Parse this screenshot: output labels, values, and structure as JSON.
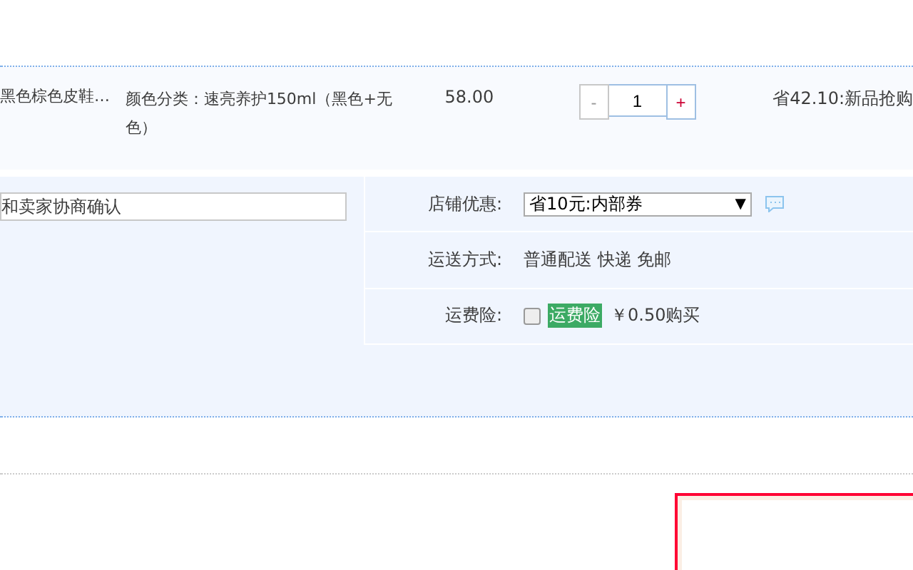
{
  "item": {
    "name": "黑色棕色皮鞋…",
    "sku": "颜色分类：速亮养护150ml（黑色+无色）",
    "price": "58.00",
    "quantity": {
      "minus": "-",
      "value": "1",
      "plus": "+"
    },
    "promotion": "省42.10:新品抢购"
  },
  "message": {
    "placeholder": "和卖家协商确认"
  },
  "options": [
    {
      "kind": "select",
      "label": "店铺优惠:",
      "value": "省10元:内部券",
      "arrow": "▼"
    },
    {
      "kind": "text",
      "label": "运送方式:",
      "value": "普通配送 快递 免邮"
    },
    {
      "kind": "insurance",
      "label": "运费险:",
      "checked": false,
      "badge": "运费险",
      "value": "￥0.50购买"
    }
  ]
}
